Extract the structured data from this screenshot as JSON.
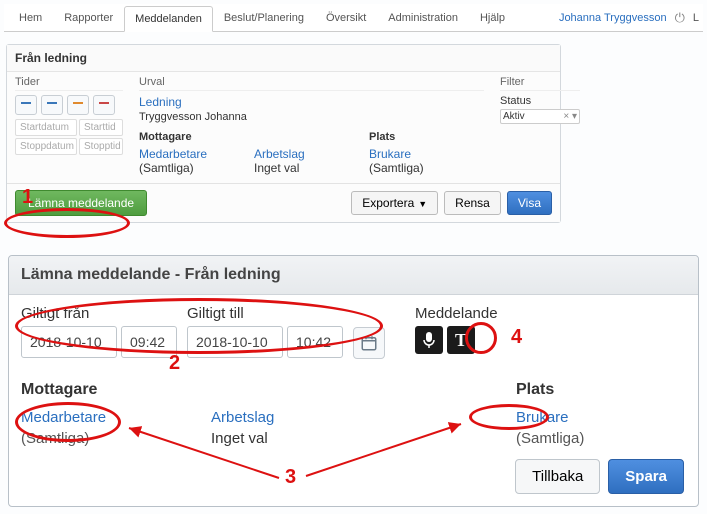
{
  "tabs": {
    "items": [
      "Hem",
      "Rapporter",
      "Meddelanden",
      "Beslut/Planering",
      "Översikt",
      "Administration",
      "Hjälp"
    ],
    "active_index": 2
  },
  "user": {
    "name": "Johanna Tryggvesson",
    "logout_label": "L"
  },
  "panel": {
    "title": "Från ledning",
    "tider_head": "Tider",
    "urval_head": "Urval",
    "filter_head": "Filter",
    "start_date_ph": "Startdatum",
    "start_time_ph": "Starttid",
    "stop_date_ph": "Stoppdatum",
    "stop_time_ph": "Stopptid",
    "ledning_link": "Ledning",
    "ledning_name": "Tryggvesson Johanna",
    "mottagare_head": "Mottagare",
    "plats_head": "Plats",
    "medarbetare_link": "Medarbetare",
    "arbetslag_link": "Arbetslag",
    "brukare_link": "Brukare",
    "samtliga": "(Samtliga)",
    "inget_val": "Inget val",
    "status_label": "Status",
    "status_value": "Aktiv",
    "lamna_btn": "Lämna meddelande",
    "exportera_btn": "Exportera",
    "rensa_btn": "Rensa",
    "visa_btn": "Visa"
  },
  "modal": {
    "title": "Lämna meddelande - Från ledning",
    "giltigt_fran": "Giltigt från",
    "giltigt_till": "Giltigt till",
    "meddelande": "Meddelande",
    "date_from": "2018-10-10",
    "time_from": "09:42",
    "date_to": "2018-10-10",
    "time_to": "10:42",
    "mottagare_head": "Mottagare",
    "plats_head": "Plats",
    "medarbetare_link": "Medarbetare",
    "arbetslag_link": "Arbetslag",
    "brukare_link": "Brukare",
    "samtliga": "(Samtliga)",
    "inget_val": "Inget val",
    "tillbaka_btn": "Tillbaka",
    "spara_btn": "Spara"
  },
  "annotations": {
    "n1": "1",
    "n2": "2",
    "n3": "3",
    "n4": "4"
  }
}
